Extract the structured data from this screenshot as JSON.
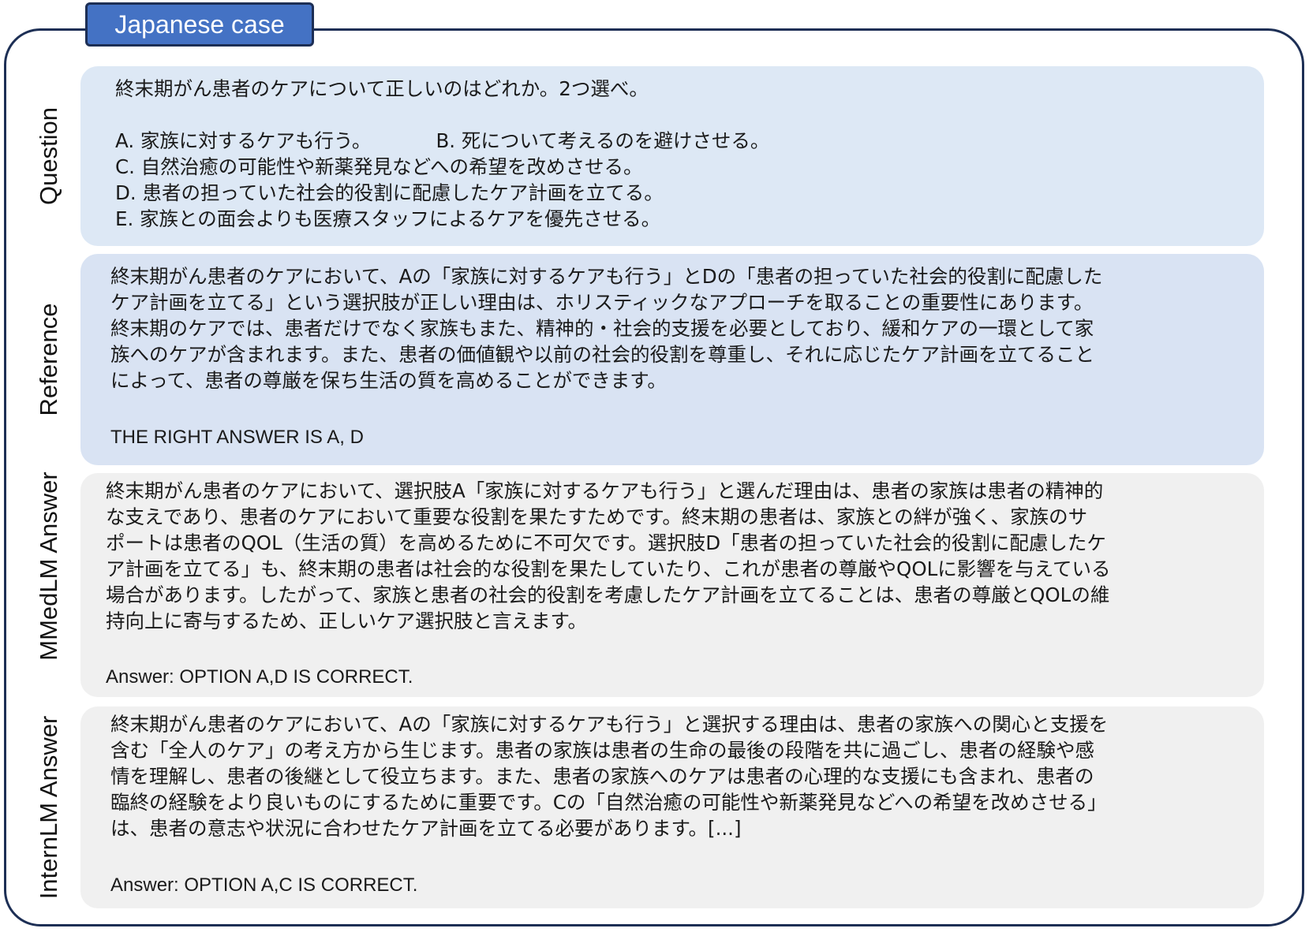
{
  "title": "Japanese case",
  "question": {
    "label": "Question",
    "stem": "終末期がん患者のケアについて正しいのはどれか。2つ選べ。",
    "options": {
      "a": "A. 家族に対するケアも行う。",
      "b": "B. 死について考えるのを避けさせる。",
      "c": "C. 自然治癒の可能性や新薬発見などへの希望を改めさせる。",
      "d": "D. 患者の担っていた社会的役割に配慮したケア計画を立てる。",
      "e": "E. 家族との面会よりも医療スタッフによるケアを優先させる。"
    }
  },
  "reference": {
    "label": "Reference",
    "lines": [
      "終末期がん患者のケアにおいて、Aの「家族に対するケアも行う」とDの「患者の担っていた社会的役割に配慮した",
      "ケア計画を立てる」という選択肢が正しい理由は、ホリスティックなアプローチを取ることの重要性にあります。",
      "終末期のケアでは、患者だけでなく家族もまた、精神的・社会的支援を必要としており、緩和ケアの一環として家",
      "族へのケアが含まれます。また、患者の価値観や以前の社会的役割を尊重し、それに応じたケア計画を立てること",
      "によって、患者の尊厳を保ち生活の質を高めることができます。"
    ],
    "answer": "THE RIGHT ANSWER IS A, D"
  },
  "mmedlm": {
    "label": "MMedLM Answer",
    "lines": [
      "終末期がん患者のケアにおいて、選択肢A「家族に対するケアも行う」と選んだ理由は、患者の家族は患者の精神的",
      "な支えであり、患者のケアにおいて重要な役割を果たすためです。終末期の患者は、家族との絆が強く、家族のサ",
      "ポートは患者のQOL（生活の質）を高めるために不可欠です。選択肢D「患者の担っていた社会的役割に配慮したケ",
      "ア計画を立てる」も、終末期の患者は社会的な役割を果たしていたり、これが患者の尊厳やQOLに影響を与えている",
      "場合があります。したがって、家族と患者の社会的役割を考慮したケア計画を立てることは、患者の尊厳とQOLの維",
      "持向上に寄与するため、正しいケア選択肢と言えます。"
    ],
    "answer": "Answer: OPTION A,D IS CORRECT."
  },
  "internlm": {
    "label": "InternLM Answer",
    "lines": [
      "終末期がん患者のケアにおいて、Aの「家族に対するケアも行う」と選択する理由は、患者の家族への関心と支援を",
      "含む「全人のケア」の考え方から生じます。患者の家族は患者の生命の最後の段階を共に過ごし、患者の経験や感",
      "情を理解し、患者の後継として役立ちます。また、患者の家族へのケアは患者の心理的な支援にも含まれ、患者の",
      "臨終の経験をより良いものにするために重要です。Cの「自然治癒の可能性や新薬発見などへの希望を改めさせる」",
      "は、患者の意志や状況に合わせたケア計画を立てる必要があります。[...]"
    ],
    "answer": "Answer: OPTION A,C IS CORRECT."
  }
}
